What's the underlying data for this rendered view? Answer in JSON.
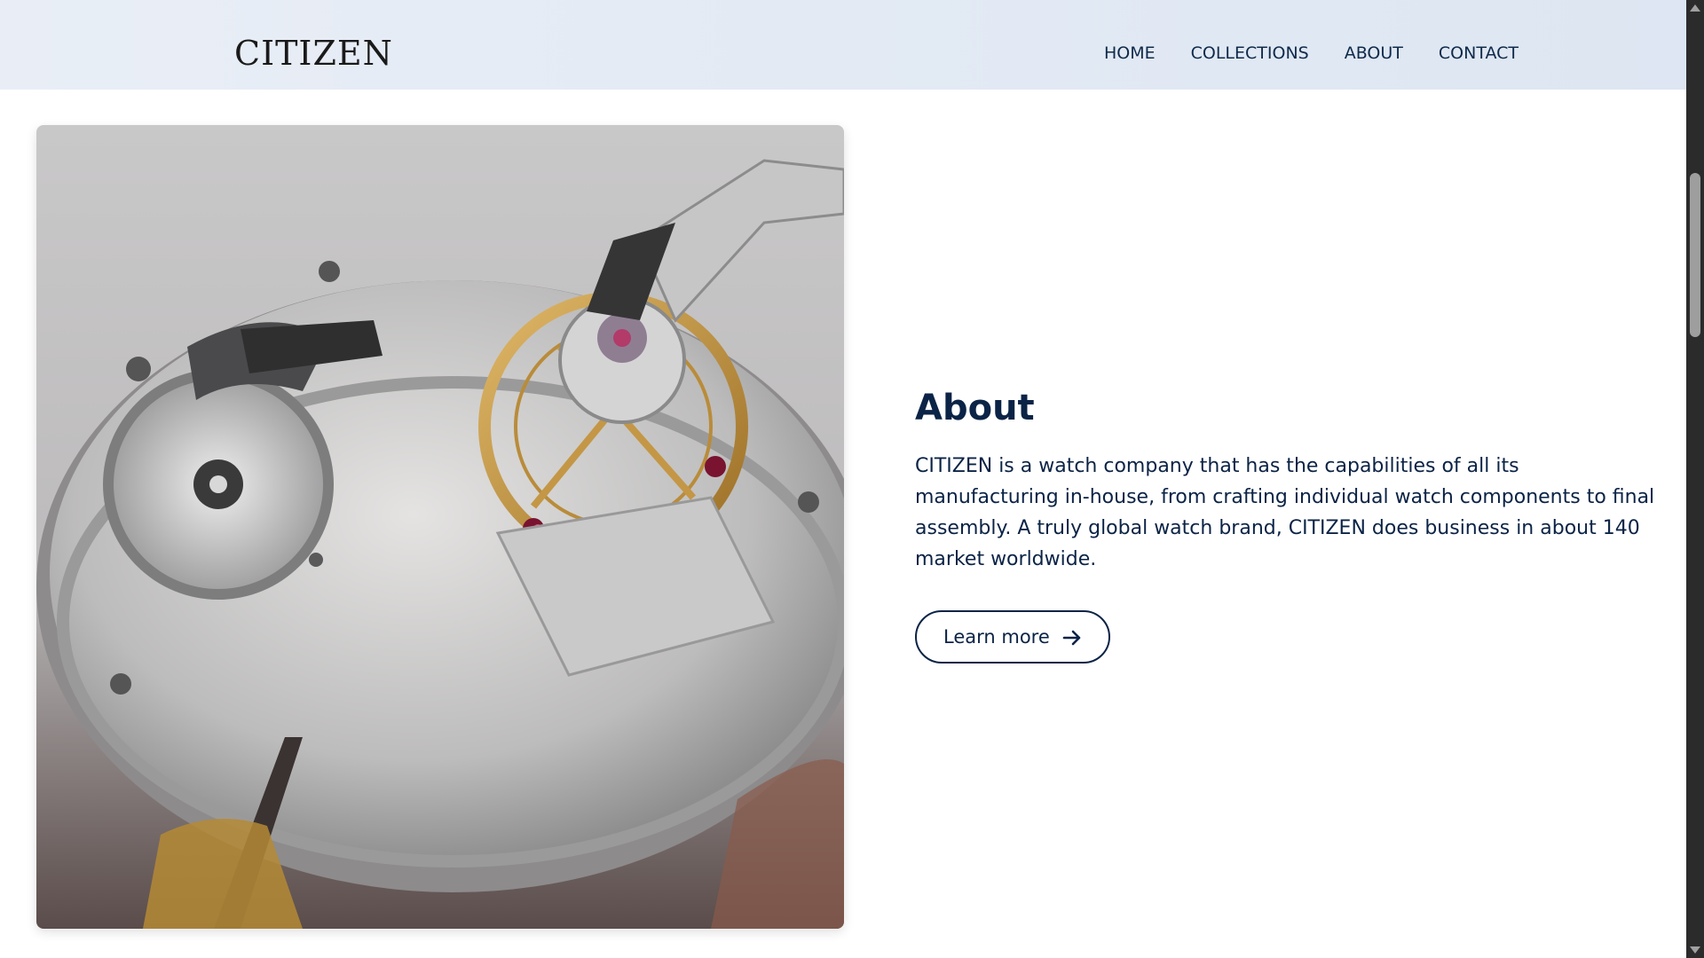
{
  "header": {
    "logo": "CITIZEN",
    "nav": [
      "HOME",
      "COLLECTIONS",
      "ABOUT",
      "CONTACT"
    ]
  },
  "hero_image": {
    "description_icon": "watch-movement-photo"
  },
  "about": {
    "title": "About",
    "text": "CITIZEN is a watch company that has the capabilities of all its manufacturing in-house, from crafting individual watch components to final assembly. A truly global watch brand, CITIZEN does business in about 140 market worldwide.",
    "button_label": "Learn more",
    "button_icon": "arrow-right-icon"
  },
  "colors": {
    "accent": "#0b2346",
    "header_bg": "#e4ebf4"
  }
}
